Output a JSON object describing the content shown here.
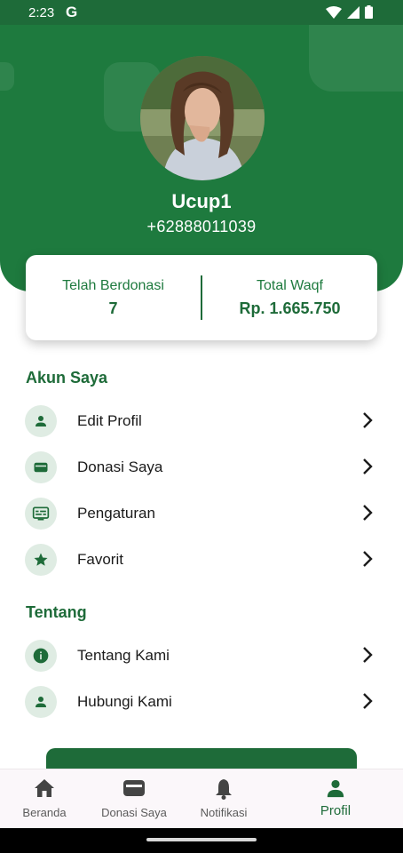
{
  "status_bar": {
    "time": "2:23",
    "g_label": "G"
  },
  "profile": {
    "name": "Ucup1",
    "phone": "+62888011039"
  },
  "stats": [
    {
      "label": "Telah Berdonasi",
      "value": "7"
    },
    {
      "label": "Total Waqf",
      "value": "Rp. 1.665.750"
    }
  ],
  "sections": {
    "akun": {
      "title": "Akun Saya",
      "items": [
        {
          "label": "Edit Profil",
          "icon": "person-icon"
        },
        {
          "label": "Donasi Saya",
          "icon": "wallet-icon"
        },
        {
          "label": "Pengaturan",
          "icon": "settings-icon"
        },
        {
          "label": "Favorit",
          "icon": "star-icon"
        }
      ]
    },
    "tentang": {
      "title": "Tentang",
      "items": [
        {
          "label": "Tentang Kami",
          "icon": "info-icon"
        },
        {
          "label": "Hubungi Kami",
          "icon": "person-icon"
        }
      ]
    }
  },
  "bottom_nav": [
    {
      "label": "Beranda",
      "icon": "home-icon",
      "active": false
    },
    {
      "label": "Donasi Saya",
      "icon": "wallet-icon",
      "active": false
    },
    {
      "label": "Notifikasi",
      "icon": "bell-icon",
      "active": false
    },
    {
      "label": "Profil",
      "icon": "person-icon",
      "active": true
    }
  ],
  "colors": {
    "primary": "#1e7a3e",
    "primary_dark": "#1e6b39",
    "icon_bg": "#dfece3"
  }
}
